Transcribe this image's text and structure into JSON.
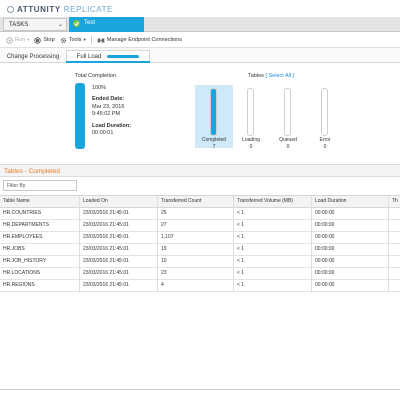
{
  "header": {
    "brand_a": "ATTUNITY",
    "brand_b": "REPLICATE"
  },
  "tabs": {
    "tasks_label": "TASKS",
    "chevron": "⌄",
    "task_tab_label": "Test"
  },
  "toolbar": {
    "run": "Run",
    "stop": "Stop",
    "tools": "Tools",
    "manage": "Manage Endpoint Connections",
    "caret": "▾"
  },
  "subtabs": {
    "change": "Change Processing",
    "full": "Full Load"
  },
  "summary": {
    "total_title": "Total Completion",
    "percent": "100%",
    "ended_label": "Ended Date:",
    "ended_date": "Mar 23, 2016",
    "ended_time": "9:45:02 PM",
    "duration_label": "Load Duration:",
    "duration": "00:00:01",
    "tables_label": "Tables",
    "select_all": "[ Select All ]"
  },
  "stats": [
    {
      "label": "Completed",
      "count": "7",
      "fill": 1.0
    },
    {
      "label": "Loading",
      "count": "0",
      "fill": 0
    },
    {
      "label": "Queued",
      "count": "0",
      "fill": 0
    },
    {
      "label": "Error",
      "count": "0",
      "fill": 0
    }
  ],
  "section": {
    "title": "Tables - Completed",
    "filter_placeholder": "Filter By"
  },
  "table": {
    "headers": [
      "Table Name",
      "Loaded On",
      "Transferred Count",
      "Transferred Volume (MB)",
      "Load Duration",
      "Th"
    ],
    "rows": [
      [
        "HR.COUNTRIES",
        "23/03/2016 21:45:01",
        "25",
        "< 1",
        "00:00:00",
        ""
      ],
      [
        "HR.DEPARTMENTS",
        "23/03/2016 21:45:01",
        "27",
        "< 1",
        "00:00:00",
        ""
      ],
      [
        "HR.EMPLOYEES",
        "23/03/2016 21:45:01",
        "1,107",
        "< 1",
        "00:00:00",
        ""
      ],
      [
        "HR.JOBS",
        "23/03/2016 21:45:01",
        "19",
        "< 1",
        "00:00:00",
        ""
      ],
      [
        "HR.JOB_HISTORY",
        "23/03/2016 21:45:01",
        "10",
        "< 1",
        "00:00:00",
        ""
      ],
      [
        "HR.LOCATIONS",
        "23/03/2016 21:45:01",
        "23",
        "< 1",
        "00:00:00",
        ""
      ],
      [
        "HR.REGIONS",
        "23/03/2016 21:45:01",
        "4",
        "< 1",
        "00:00:00",
        ""
      ]
    ]
  },
  "colors": {
    "accent": "#1aa6dc",
    "section_title": "#e87a22",
    "link": "#1a8fd8"
  }
}
